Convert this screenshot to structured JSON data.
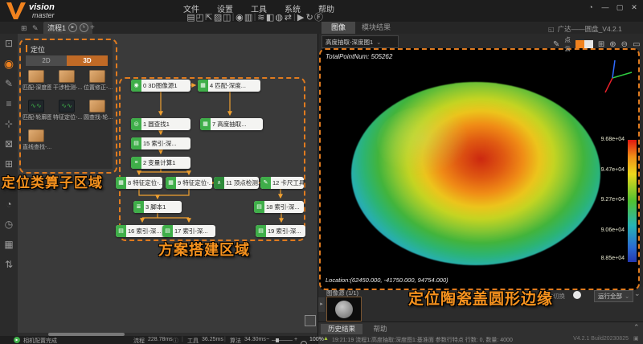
{
  "window": {
    "logo": {
      "line1": "vision",
      "line2": "master"
    },
    "menus": [
      "文件",
      "设置",
      "工具",
      "系统",
      "帮助"
    ],
    "controls": [
      "◔",
      "—",
      "▢",
      "✕"
    ],
    "doc_label": "广达——圆盘_V4.2.1"
  },
  "toolbar": {
    "icons": [
      "▤",
      "◰",
      "⇱",
      "▨",
      "◫",
      "◉",
      "▥",
      "≋",
      "◧",
      "◍",
      "⇄",
      "▶",
      "↻",
      "Ⓕ"
    ],
    "sep": "|"
  },
  "flow_tabs": {
    "tool1": "⊞",
    "tool2": "✎",
    "tab_label": "流程1",
    "run_icon": "▶",
    "loop_icon": "↻",
    "add_label": "+"
  },
  "left_strip": {
    "icons": [
      "⊡",
      "◉",
      "✎",
      "≡",
      "⊹",
      "⊠",
      "⊞",
      "✦",
      "◔",
      "◷",
      "▦",
      "⇅"
    ],
    "more": "»"
  },
  "palette": {
    "header": "定位",
    "tab_2d": "2D",
    "tab_3d": "3D",
    "wave_glyph": "∿∿",
    "items": [
      {
        "label": "匹配-深度图"
      },
      {
        "label": "干涉检测-..."
      },
      {
        "label": "位置修正-..."
      },
      {
        "label": "匹配-轮廓图"
      },
      {
        "label": "特征定位-..."
      },
      {
        "label": "圆查找-轮..."
      },
      {
        "label": "直线查找-..."
      }
    ]
  },
  "flowchart": {
    "blocks": [
      {
        "label": "0 3D图像源1",
        "glyph": "◉"
      },
      {
        "label": "4 匹配-深度...",
        "glyph": "▦"
      },
      {
        "label": "1 圆查找1",
        "glyph": "◎"
      },
      {
        "label": "7 高度抽取...",
        "glyph": "▦"
      },
      {
        "label": "15 索引-深...",
        "glyph": "▤"
      },
      {
        "label": "2 变量计算1",
        "glyph": "≡"
      },
      {
        "label": "8 特征定位-...",
        "glyph": "▦"
      },
      {
        "label": "9 特征定位-...",
        "glyph": "▦"
      },
      {
        "label": "11 顶点检测1",
        "glyph": "∧"
      },
      {
        "label": "12 卡尺工具1",
        "glyph": "✎"
      },
      {
        "label": "3 脚本1",
        "glyph": "≣"
      },
      {
        "label": "16 索引-深...",
        "glyph": "▤"
      },
      {
        "label": "17 索引-深...",
        "glyph": "▤"
      },
      {
        "label": "18 索引-深...",
        "glyph": "▤"
      },
      {
        "label": "19 索引-深...",
        "glyph": "▤"
      }
    ]
  },
  "annotations": {
    "palette_region": "定位类算子区域",
    "build_region": "方案搭建区域",
    "viewport_region": "定位陶瓷盖圆形边缘"
  },
  "right_panel": {
    "tab_image": "图像",
    "tab_module": "模块结果",
    "source_select": "高度抽取-深度图1",
    "edit_icon": "✎",
    "pointcloud_label": "点云",
    "view_icons": [
      "⊞",
      "⊕",
      "⊖",
      "▭",
      "◱"
    ],
    "total_points": "TotalPointNum: 505262",
    "location": "Location:(62450.000, -41750.000, 94754.000)",
    "colorbar_labels": [
      "9.68e+04",
      "9.47e+04",
      "9.27e+04",
      "9.06e+04",
      "8.85e+04"
    ],
    "image_source_label": "图像源 (1/1)",
    "collapse_icon": "▸",
    "auto_switch_label": "自动切换",
    "run_select": "运行全部",
    "chevron_down": "⌄"
  },
  "bottom_panel": {
    "tab_history": "历史结果",
    "tab_help": "帮助",
    "collapse_up": "⌃",
    "warn_icon": "▲",
    "log": "19:21:19 流程1:高度抽取:深度图1:基准面 参数行特点 行数: 0, 数量: 4000",
    "version": "V4.2.1 Build20230825",
    "panel_icon": "▣"
  },
  "statusbar": {
    "run_glyph": "▶",
    "status": "相机配置完成",
    "m1_label": "流程",
    "m1_value": "228.78ms",
    "info_icon": "ⓘ",
    "m2_label": "工具",
    "m2_value": "36.25ms",
    "m3_label": "算法",
    "m3_value": "34.30ms",
    "minus": "−",
    "plus": "+",
    "zoom": "100%"
  }
}
